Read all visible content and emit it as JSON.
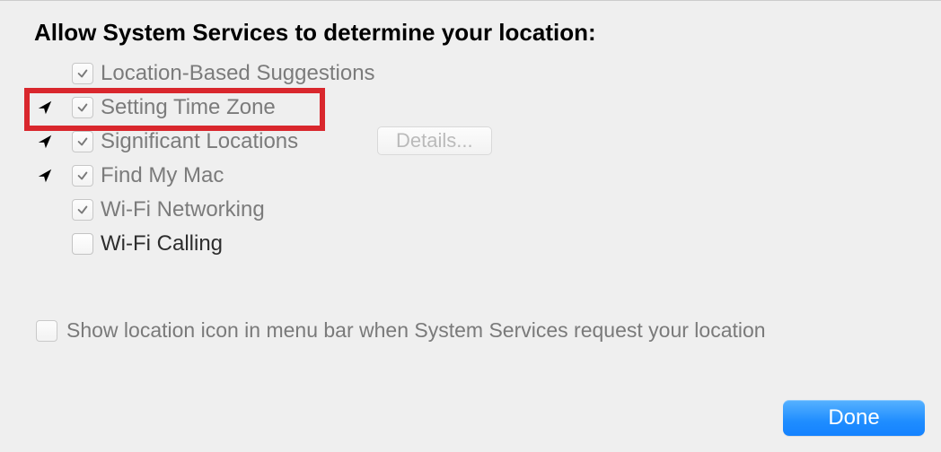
{
  "heading": "Allow System Services to determine your location:",
  "services": [
    {
      "label": "Location-Based Suggestions",
      "checked": true,
      "active_indicator": false,
      "enabled": false
    },
    {
      "label": "Setting Time Zone",
      "checked": true,
      "active_indicator": true,
      "enabled": false,
      "highlighted": true
    },
    {
      "label": "Significant Locations",
      "checked": true,
      "active_indicator": true,
      "enabled": false,
      "has_details": true
    },
    {
      "label": "Find My Mac",
      "checked": true,
      "active_indicator": true,
      "enabled": false
    },
    {
      "label": "Wi-Fi Networking",
      "checked": true,
      "active_indicator": false,
      "enabled": false
    },
    {
      "label": "Wi-Fi Calling",
      "checked": false,
      "active_indicator": false,
      "enabled": true
    }
  ],
  "details_button": "Details...",
  "menubar_toggle": {
    "label": "Show location icon in menu bar when System Services request your location",
    "checked": false
  },
  "done_button": "Done",
  "colors": {
    "highlight": "#d9272d",
    "primary_button": "#1f8dff"
  }
}
